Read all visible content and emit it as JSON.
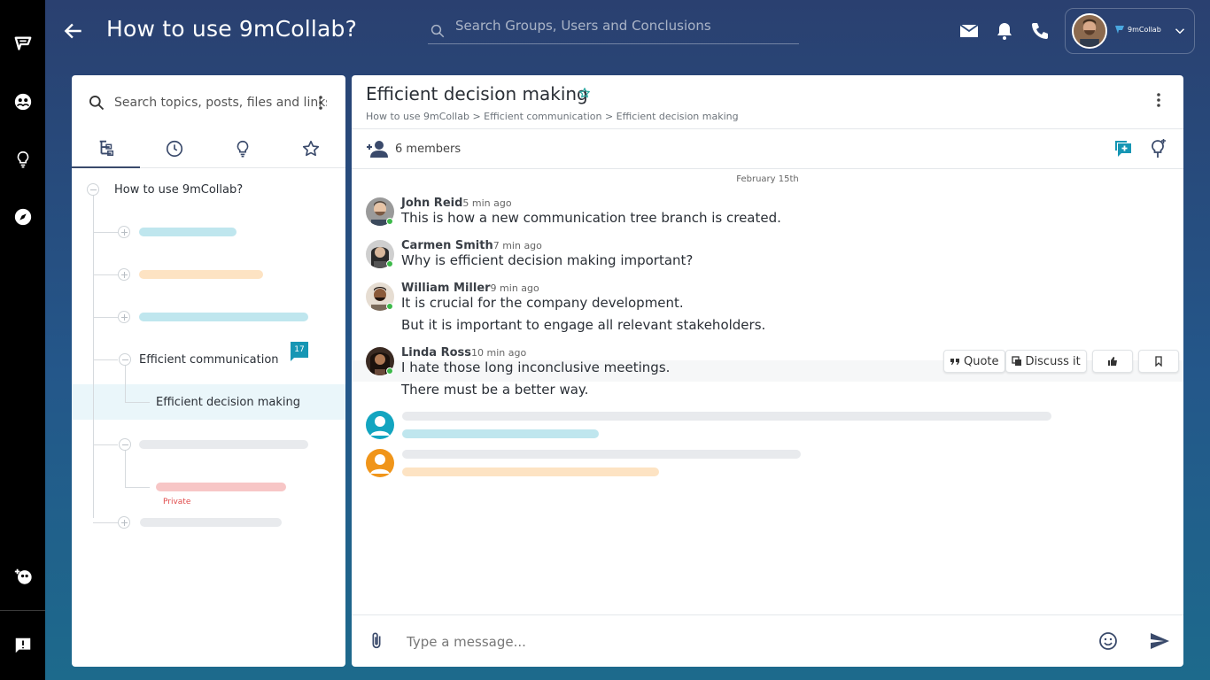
{
  "header": {
    "title": "How to use 9mCollab?",
    "search_placeholder": "Search Groups, Users and Conclusions",
    "brand": "9mCollab"
  },
  "left_panel": {
    "search_placeholder": "Search topics, posts, files and links...",
    "tree": {
      "root": "How to use 9mCollab?",
      "badge_count": "17",
      "branch": "Efficient communication",
      "selected": "Efficient decision making",
      "private_label": "Private"
    }
  },
  "main": {
    "title": "Efficient decision making",
    "breadcrumb": "How to use 9mCollab > Efficient communication > Efficient decision making",
    "members": "6 members",
    "date": "February 15th",
    "messages": [
      {
        "name": "John Reid",
        "time": "5 min ago",
        "lines": [
          "This is how a new communication tree branch is created."
        ]
      },
      {
        "name": "Carmen Smith",
        "time": "7 min ago",
        "lines": [
          "Why is efficient decision making important?"
        ]
      },
      {
        "name": "William Miller",
        "time": "9 min ago",
        "lines": [
          "It is crucial for the company development.",
          "But it is important to engage all relevant stakeholders."
        ]
      },
      {
        "name": "Linda Ross",
        "time": "10 min ago",
        "lines": [
          "I hate those long inconclusive meetings.",
          "There must be a better way."
        ]
      }
    ],
    "actions": {
      "quote": "Quote",
      "discuss": "Discuss it"
    },
    "composer_placeholder": "Type a message..."
  },
  "colors": {
    "accent": "#1696b4",
    "skeleton_blue": "#bfe6ee",
    "skeleton_orange": "#fde3c3",
    "skeleton_grey": "#e8eaed",
    "skeleton_red": "#f7c6c6",
    "online": "#3cb94a"
  },
  "icons": [
    "logo-icon",
    "group-icon",
    "idea-icon",
    "compass-icon",
    "add-group-icon",
    "feedback-icon",
    "back-arrow-icon",
    "search-icon",
    "mail-icon",
    "bell-icon",
    "phone-icon",
    "chevron-down-icon",
    "tree-icon",
    "clock-icon",
    "bulb-icon",
    "star-icon",
    "add-member-icon",
    "new-chat-icon",
    "bulb-pin-icon",
    "attach-icon",
    "emoji-icon",
    "send-icon",
    "quote-icon",
    "discuss-icon",
    "thumbs-up-icon",
    "bookmark-icon"
  ]
}
